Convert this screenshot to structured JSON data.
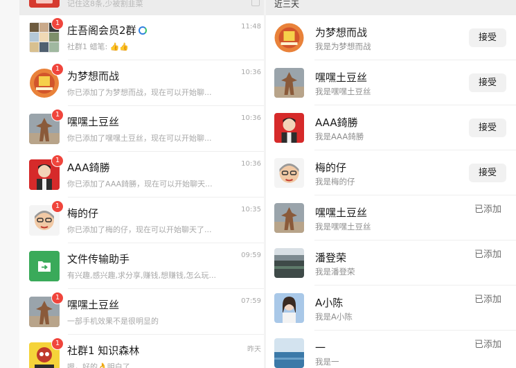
{
  "chats": [
    {
      "name": "",
      "preview": "记住这8条,少被割韭菜",
      "time": "",
      "avatar": "red-logo-avatar",
      "badge": ""
    },
    {
      "name": "庄吾阁会员2群",
      "preview": "社群1 蜡笔: 👍👍",
      "time": "11:48",
      "avatar": "group-grid-avatar",
      "badge": "1"
    },
    {
      "name": "为梦想而战",
      "preview": "你已添加了为梦想而战，现在可以开始聊...",
      "time": "10:36",
      "avatar": "orange-round-avatar",
      "badge": "1"
    },
    {
      "name": "嘿嘿土豆丝",
      "preview": "你已添加了嘿嘿土豆丝，现在可以开始聊...",
      "time": "10:36",
      "avatar": "statue-avatar",
      "badge": "1"
    },
    {
      "name": "AAA錡勝",
      "preview": "你已添加了AAA錡勝，现在可以开始聊天...",
      "time": "10:36",
      "avatar": "cartoon-man-avatar",
      "badge": "1"
    },
    {
      "name": "梅的仔",
      "preview": "你已添加了梅的仔，现在可以开始聊天了...",
      "time": "10:35",
      "avatar": "old-man-avatar",
      "badge": "1"
    },
    {
      "name": "文件传输助手",
      "preview": "有兴趣,感兴趣,求分享,赚钱,想赚钱,怎么玩...",
      "time": "09:59",
      "avatar": "file-transfer-icon",
      "badge": ""
    },
    {
      "name": "嘿嘿土豆丝",
      "preview": "一部手机效果不是很明显的",
      "time": "07:59",
      "avatar": "statue-avatar",
      "badge": "1"
    },
    {
      "name": "社群1 知识森林",
      "preview": "嗯，好的👌明白了",
      "time": "昨天",
      "avatar": "knowledge-forest-avatar",
      "badge": "1"
    }
  ],
  "requests_section": {
    "title": "近三天"
  },
  "requests": [
    {
      "name": "为梦想而战",
      "message": "我是为梦想而战",
      "action": "接受",
      "status": "pending",
      "avatar": "orange-round-avatar"
    },
    {
      "name": "嘿嘿土豆丝",
      "message": "我是嘿嘿土豆丝",
      "action": "接受",
      "status": "pending",
      "avatar": "statue-avatar"
    },
    {
      "name": "AAA錡勝",
      "message": "我是AAA錡勝",
      "action": "接受",
      "status": "pending",
      "avatar": "cartoon-man-avatar"
    },
    {
      "name": "梅的仔",
      "message": "我是梅的仔",
      "action": "接受",
      "status": "pending",
      "avatar": "old-man-avatar"
    },
    {
      "name": "嘿嘿土豆丝",
      "message": "我是嘿嘿土豆丝",
      "action": "已添加",
      "status": "added",
      "avatar": "statue-avatar"
    },
    {
      "name": "潘登荣",
      "message": "我是潘登荣",
      "action": "已添加",
      "status": "added",
      "avatar": "landscape-avatar"
    },
    {
      "name": "A小陈",
      "message": "我是A小陈",
      "action": "已添加",
      "status": "added",
      "avatar": "girl-photo-avatar"
    },
    {
      "name": "一",
      "message": "我是一",
      "action": "已添加",
      "status": "added",
      "avatar": "sea-avatar"
    }
  ]
}
